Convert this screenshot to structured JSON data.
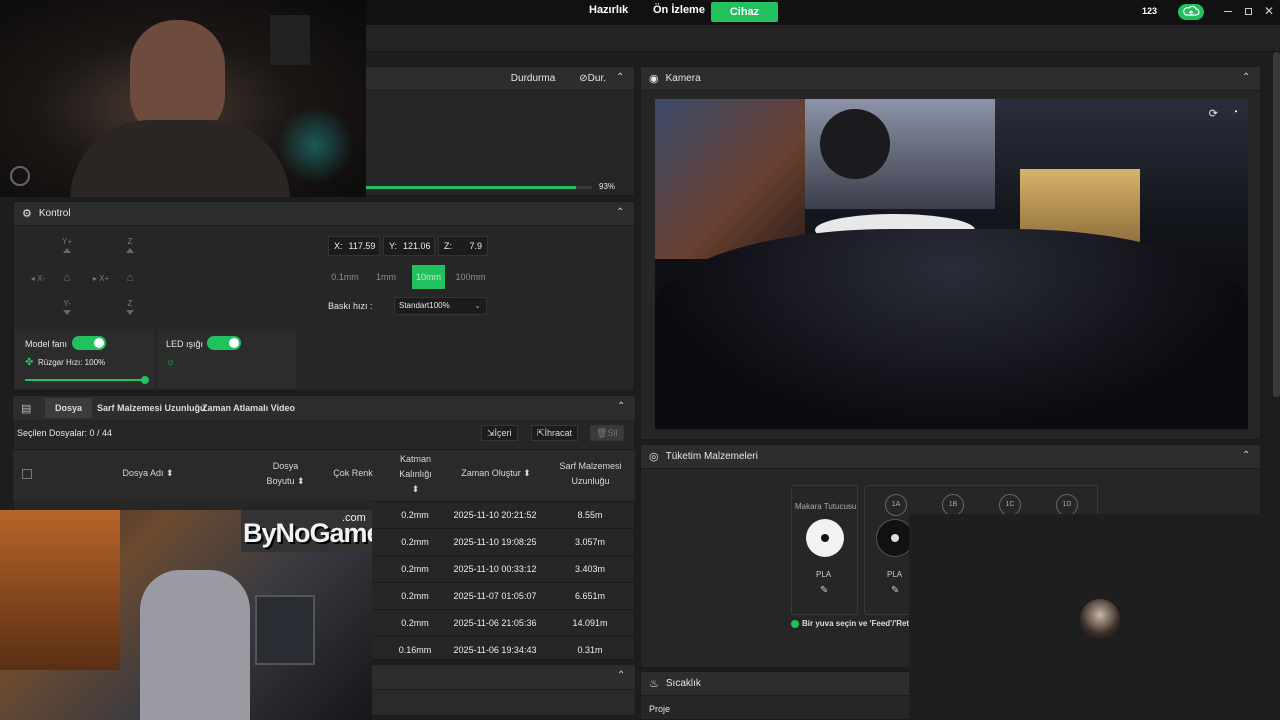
{
  "topbar": {
    "nav": [
      "Hazırlık",
      "Ön İzleme",
      "Cihaz"
    ],
    "user_number": "123",
    "icons": [
      "cloud-upload-icon",
      "minimize-icon",
      "restore-icon",
      "close-icon"
    ]
  },
  "status_panel": {
    "stop_label": "Durdurma",
    "pause_label": "Dur.",
    "progress_percent": 93,
    "progress_text": "93%"
  },
  "control": {
    "title": "Kontrol",
    "jog": {
      "y_plus": "Y+",
      "y_minus": "Y-",
      "x_minus": "X-",
      "x_plus": "X+",
      "z_up": "Z",
      "z_down": "Z"
    },
    "coords": {
      "x_label": "X:",
      "x_value": "117.59",
      "y_label": "Y:",
      "y_value": "121.06",
      "z_label": "Z:",
      "z_value": "7.9"
    },
    "steps": [
      "0.1mm",
      "1mm",
      "10mm",
      "100mm"
    ],
    "selected_step": "10mm",
    "speed_label": "Baskı hızı :",
    "speed_value": "Standart100%",
    "model_fan_label": "Model fanı",
    "wind_speed_label": "Rüzgar Hızı: 100%",
    "wind_speed_fraction": 1.0,
    "led_label": "LED ışığı"
  },
  "files": {
    "tabs": [
      "Dosya",
      "Sarf Malzemesi Uzunluğu",
      "Zaman Atlamalı Video"
    ],
    "selected_count": "Seçilen Dosyalar: 0 / 44",
    "import_label": "İçeri",
    "export_label": "İhracat",
    "delete_label": "Sil",
    "columns": {
      "name": "Dosya Adı",
      "size_1": "Dosya",
      "size_2": "Boyutu",
      "multicolor": "Çok Renk",
      "layer_1": "Katman",
      "layer_2": "Kalınlığı",
      "created": "Zaman Oluştur",
      "filament_1": "Sarf Malzemesi",
      "filament_2": "Uzunluğu"
    },
    "rows": [
      {
        "layer": "0.2mm",
        "created": "2025-11-10 20:21:52",
        "length": "8.55m"
      },
      {
        "layer": "0.2mm",
        "created": "2025-11-10 19:08:25",
        "length": "3.057m"
      },
      {
        "layer": "0.2mm",
        "created": "2025-11-10 00:33:12",
        "length": "3.403m"
      },
      {
        "layer": "0.2mm",
        "created": "2025-11-07 01:05:07",
        "length": "6.651m"
      },
      {
        "layer": "0.2mm",
        "created": "2025-11-06 21:05:36",
        "length": "14.091m"
      },
      {
        "layer": "0.16mm",
        "created": "2025-11-06 19:34:43",
        "length": "0.31m"
      }
    ]
  },
  "camera": {
    "title": "Kamera"
  },
  "consumables": {
    "title": "Tüketim Malzemeleri",
    "spool_holder": "Makara Tutucusu",
    "slots": [
      "1A",
      "1B",
      "1C",
      "1D"
    ],
    "material_1": "PLA",
    "material_2": "PLA",
    "hint": "Bir yuva seçin ve 'Feed'/'Ret"
  },
  "temperature": {
    "title": "Sıcaklık",
    "project_label": "Proje"
  },
  "overlay": {
    "brand_main": "ByNoGame",
    "brand_suffix": ".com"
  },
  "colors": {
    "accent": "#21c25e",
    "panel": "#262626",
    "header": "#2d2d2d"
  }
}
